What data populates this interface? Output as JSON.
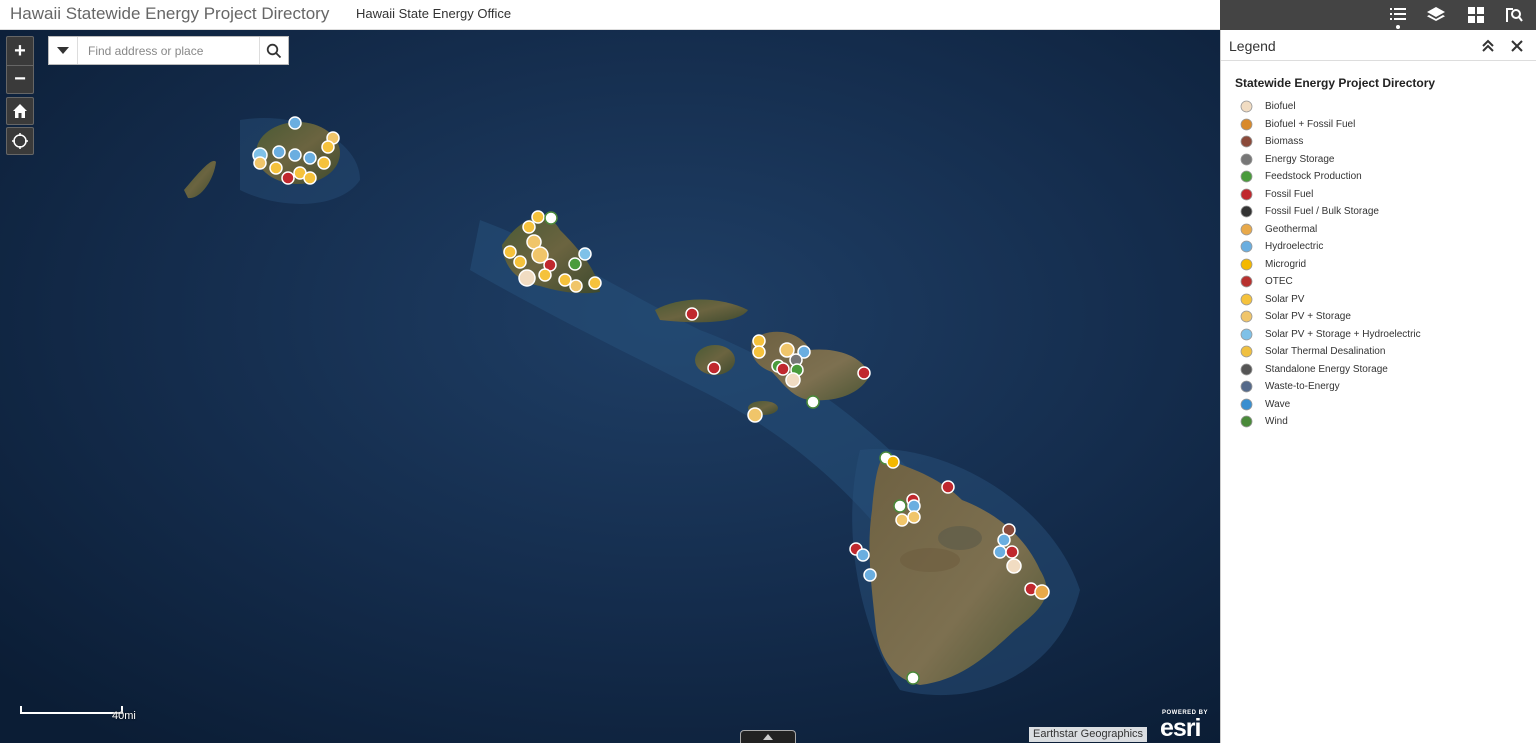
{
  "header": {
    "title": "Hawaii Statewide Energy Project Directory",
    "subtitle": "Hawaii State Energy Office"
  },
  "toolbar": {
    "tools": [
      "legend-list-icon",
      "layers-icon",
      "basemap-gallery-icon",
      "search-details-icon"
    ],
    "active_tool": "legend-list-icon"
  },
  "map": {
    "search_placeholder": "Find address or place",
    "zoom_in": "+",
    "zoom_out": "−",
    "scale_label": "40mi",
    "attribution": "Earthstar Geographics",
    "esri_powered": "POWERED BY",
    "esri_word": "esri"
  },
  "legend": {
    "title": "Legend",
    "layer_title": "Statewide Energy Project Directory",
    "items": [
      {
        "label": "Biofuel",
        "icon": "biofuel-icon",
        "color": "#f1dcc2"
      },
      {
        "label": "Biofuel + Fossil Fuel",
        "icon": "biofuel-fossil-icon",
        "color": "#d98a2b"
      },
      {
        "label": "Biomass",
        "icon": "biomass-icon",
        "color": "#8b4a3a"
      },
      {
        "label": "Energy Storage",
        "icon": "battery-icon",
        "color": "#777777"
      },
      {
        "label": "Feedstock Production",
        "icon": "feedstock-icon",
        "color": "#4a9b3c"
      },
      {
        "label": "Fossil Fuel",
        "icon": "fossil-fuel-icon",
        "color": "#c0282e"
      },
      {
        "label": "Fossil Fuel / Bulk Storage",
        "icon": "bulk-storage-icon",
        "color": "#333333"
      },
      {
        "label": "Geothermal",
        "icon": "geothermal-icon",
        "color": "#e8a94a"
      },
      {
        "label": "Hydroelectric",
        "icon": "hydro-drop-icon",
        "color": "#6aaee0"
      },
      {
        "label": "Microgrid",
        "icon": "microgrid-icon",
        "color": "#f4b800"
      },
      {
        "label": "OTEC",
        "icon": "otec-drop-icon",
        "color": "#b8312f"
      },
      {
        "label": "Solar PV",
        "icon": "sun-icon",
        "color": "#f5c23c"
      },
      {
        "label": "Solar PV + Storage",
        "icon": "sun-storage-icon",
        "color": "#f0c56a"
      },
      {
        "label": "Solar PV + Storage + Hydroelectric",
        "icon": "sun-hydro-icon",
        "color": "#7fc1e8"
      },
      {
        "label": "Solar Thermal Desalination",
        "icon": "desalination-icon",
        "color": "#f0c040"
      },
      {
        "label": "Standalone Energy Storage",
        "icon": "standalone-battery-icon",
        "color": "#555555"
      },
      {
        "label": "Waste-to-Energy",
        "icon": "waste-energy-icon",
        "color": "#556a8a"
      },
      {
        "label": "Wave",
        "icon": "wave-icon",
        "color": "#3a8fd0"
      },
      {
        "label": "Wind",
        "icon": "wind-turbine-icon",
        "color": "#4a8a3a"
      }
    ]
  }
}
